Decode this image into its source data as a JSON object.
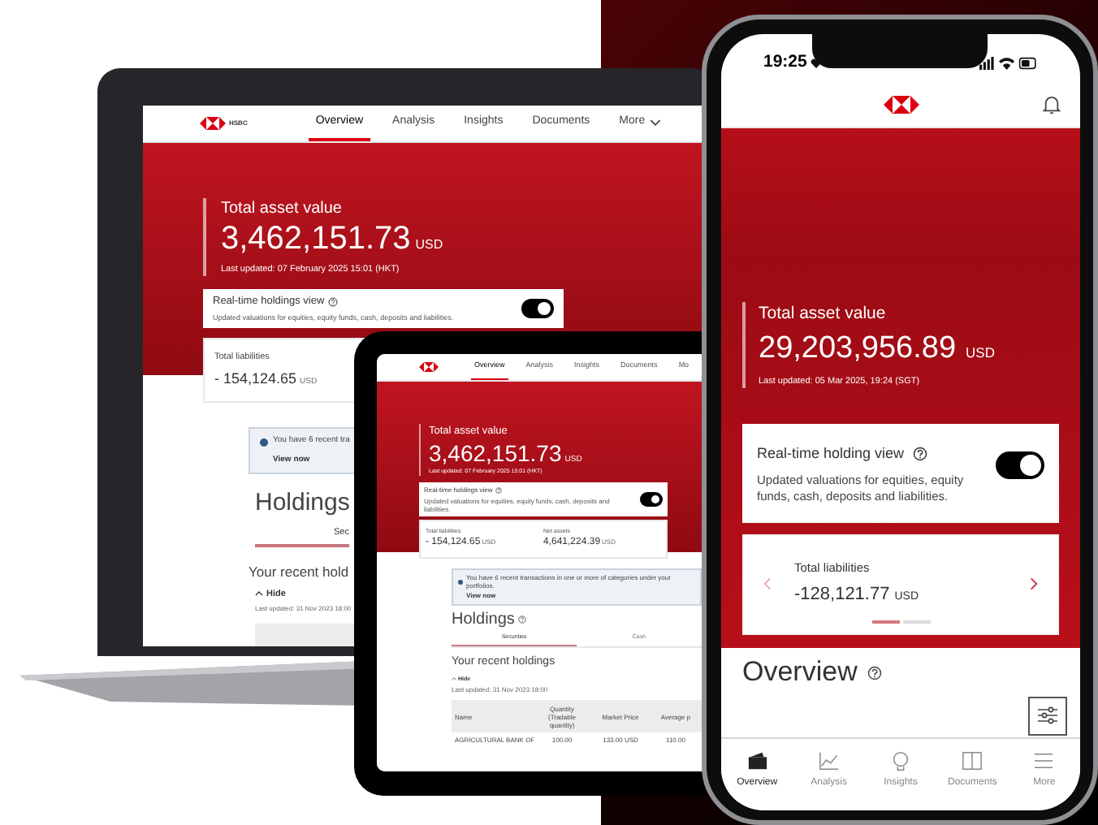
{
  "laptop": {
    "logo_text": "HSBC",
    "nav": [
      {
        "label": "Overview",
        "selected": true,
        "kind": "link"
      },
      {
        "label": "Analysis",
        "selected": false,
        "kind": "link"
      },
      {
        "label": "Insights",
        "selected": false,
        "kind": "link"
      },
      {
        "label": "Documents",
        "selected": false,
        "kind": "link"
      },
      {
        "label": "More",
        "selected": false,
        "kind": "menu"
      }
    ],
    "hero": {
      "title": "Total asset value",
      "amount": "3,462,151.73",
      "currency": "USD",
      "updated": "Last updated:  07 February 2025 15:01 (HKT)"
    },
    "holding_view": {
      "title": "Real-time holdings view",
      "description": "Updated valuations for equities, equity funds, cash, deposits and liabilities.",
      "on": true
    },
    "liabilities": {
      "label": "Total liabilities",
      "amount": "- 154,124.65",
      "currency": "USD"
    },
    "banner": {
      "text": "You have 6 recent tra",
      "link": "View now"
    },
    "holdings": {
      "title": "Holdings",
      "tab": "Sec"
    },
    "recent": {
      "title": "Your recent hold",
      "hide": "Hide",
      "updated": "Last updated: 31 Nov 2023 18:00"
    }
  },
  "tablet": {
    "nav": [
      {
        "label": "Overview",
        "selected": true
      },
      {
        "label": "Analysis",
        "selected": false
      },
      {
        "label": "Insights",
        "selected": false
      },
      {
        "label": "Documents",
        "selected": false
      },
      {
        "label": "Mo",
        "selected": false
      }
    ],
    "hero": {
      "title": "Total asset value",
      "amount": "3,462,151.73",
      "currency": "USD",
      "updated": "Last updated: 07 February 2025 15:01 (HKT)"
    },
    "holding_view": {
      "title": "Real-time holdings view",
      "description": "Updated valuations for equities, equity funds, cash, deposits and liabilities.",
      "on": true
    },
    "summary": [
      {
        "label": "Total liabilities",
        "amount": "- 154,124.65",
        "currency": "USD"
      },
      {
        "label": "Net assets",
        "amount": "4,641,224.39",
        "currency": "USD"
      }
    ],
    "banner": {
      "text": "You have 6 recent transactions in one or more of categories under your portfolios.",
      "link": "View now"
    },
    "holdings": {
      "title": "Holdings",
      "tabs": [
        {
          "label": "Securities",
          "selected": true
        },
        {
          "label": "Cash",
          "selected": false
        }
      ]
    },
    "recent": {
      "title": "Your recent holdings",
      "hide": "Hide",
      "updated": "Last updated: 31 Nov 2023 18:00"
    },
    "table": {
      "columns": [
        "Name",
        "Quantity (Tradable quantity)",
        "Market Price",
        "Average p"
      ],
      "rows": [
        [
          "AGRICULTURAL BANK OF",
          "100.00",
          "133.00 USD",
          "110.00"
        ]
      ]
    }
  },
  "phone": {
    "time": "19:25",
    "hero": {
      "title": "Total asset value",
      "amount": "29,203,956.89",
      "currency": "USD",
      "updated": "Last updated: 05 Mar 2025, 19:24 (SGT)"
    },
    "holding_view": {
      "title": "Real-time holding view",
      "description": "Updated valuations for equities, equity funds, cash, deposits and liabilities.",
      "on": true
    },
    "liabilities": {
      "label": "Total liabilities",
      "amount": "-128,121.77",
      "currency": "USD"
    },
    "carousel_dots": [
      {
        "selected": true
      },
      {
        "selected": false
      }
    ],
    "overview_title": "Overview",
    "tabs": [
      {
        "label": "Overview",
        "selected": true,
        "kind": "wallet"
      },
      {
        "label": "Analysis",
        "selected": false,
        "kind": "chart"
      },
      {
        "label": "Insights",
        "selected": false,
        "kind": "bulb"
      },
      {
        "label": "Documents",
        "selected": false,
        "kind": "book"
      },
      {
        "label": "More",
        "selected": false,
        "kind": "menu"
      }
    ]
  }
}
